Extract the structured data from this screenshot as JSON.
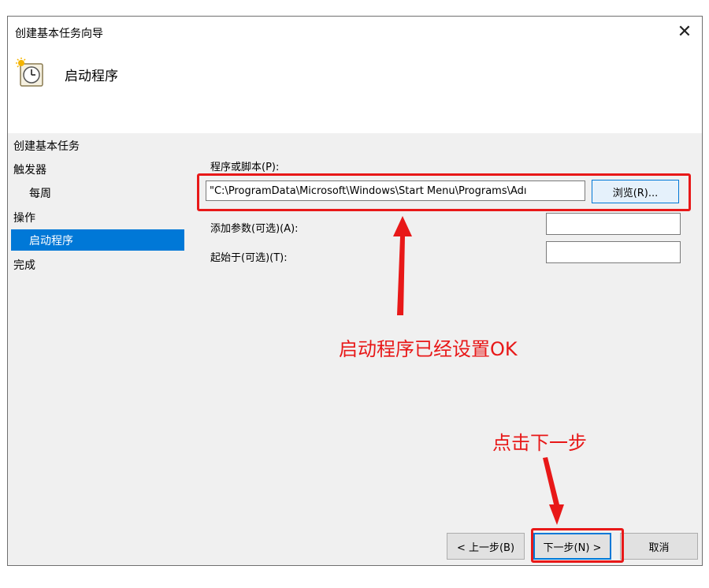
{
  "window": {
    "title": "创建基本任务向导",
    "close_glyph": "✕"
  },
  "header": {
    "title": "启动程序",
    "icon": "task-scheduler-clock-icon"
  },
  "nav": {
    "items": [
      {
        "label": "创建基本任务",
        "indent": false,
        "active": false
      },
      {
        "label": "触发器",
        "indent": false,
        "active": false
      },
      {
        "label": "每周",
        "indent": true,
        "active": false
      },
      {
        "label": "操作",
        "indent": false,
        "active": false
      },
      {
        "label": "启动程序",
        "indent": true,
        "active": true
      },
      {
        "label": "完成",
        "indent": false,
        "active": false
      }
    ]
  },
  "form": {
    "program_label": "程序或脚本(P):",
    "program_value": "\"C:\\ProgramData\\Microsoft\\Windows\\Start Menu\\Programs\\Adı",
    "browse_label": "浏览(R)...",
    "args_label": "添加参数(可选)(A):",
    "args_value": "",
    "start_in_label": "起始于(可选)(T):",
    "start_in_value": ""
  },
  "footer": {
    "back_label": "< 上一步(B)",
    "next_label": "下一步(N) >",
    "cancel_label": "取消"
  },
  "annotations": {
    "note_program": "启动程序已经设置OK",
    "note_next": "点击下一步",
    "color": "#e81818"
  },
  "colors": {
    "selection": "#0078d7",
    "dialog_bg": "#f0f0f0"
  }
}
